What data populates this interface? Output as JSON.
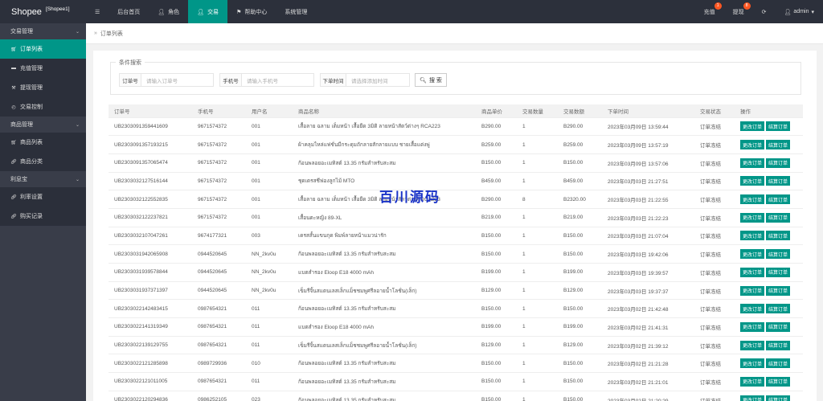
{
  "app": {
    "brand": "Shopee",
    "sub": "[Shopee1]"
  },
  "topnav": {
    "menu_icon": "hamburger-icon",
    "items": [
      {
        "label": "后台首页",
        "icon": ""
      },
      {
        "label": "角色",
        "icon": "user-icon"
      },
      {
        "label": "交易",
        "icon": "user-icon",
        "active": true
      },
      {
        "label": "帮助中心",
        "icon": "flag-icon"
      },
      {
        "label": "系统管理",
        "icon": ""
      }
    ]
  },
  "topright": {
    "recharge": {
      "label": "充值",
      "badge": "1"
    },
    "withdraw": {
      "label": "提现",
      "badge": "8"
    },
    "refresh_icon": "refresh-icon",
    "user": "admin"
  },
  "sidebar": {
    "groups": [
      {
        "label": "交易管理",
        "items": [
          {
            "label": "订单列表",
            "icon": "cart-icon",
            "active": true
          },
          {
            "label": "充值管理",
            "icon": "card-icon"
          },
          {
            "label": "提现管理",
            "icon": "hammer-icon"
          },
          {
            "label": "交易控制",
            "icon": "dashboard-icon"
          }
        ]
      },
      {
        "label": "商品管理",
        "items": [
          {
            "label": "商品列表",
            "icon": "cart-icon"
          },
          {
            "label": "商品分类",
            "icon": "link-icon"
          }
        ]
      },
      {
        "label": "利息宝",
        "items": [
          {
            "label": "利率设置",
            "icon": "link-icon"
          },
          {
            "label": "购买记录",
            "icon": "link-icon"
          }
        ]
      }
    ]
  },
  "breadcrumb": {
    "sep": "»",
    "label": "订单列表"
  },
  "search": {
    "legend": "条件搜索",
    "fields": [
      {
        "label": "订单号",
        "placeholder": "请输入订单号"
      },
      {
        "label": "手机号",
        "placeholder": "请输入手机号"
      },
      {
        "label": "下单时间",
        "placeholder": "请选择添加时间"
      }
    ],
    "button": "搜 索"
  },
  "table": {
    "headers": [
      "订单号",
      "手机号",
      "用户名",
      "商品名称",
      "商品单价",
      "交易数量",
      "交易数额",
      "下单时间",
      "交易状态",
      "操作"
    ],
    "action_edit": "更改订单",
    "action_settle": "结算订单",
    "rows": [
      [
        "UB2303091359441609",
        "9671574372",
        "001",
        "เสื้อลาย ฉลาม เต็มหน้า เสื้อยืด 3มิติ ลายหน้าสัตว์ต่างๆ RCA223",
        "B290.00",
        "1",
        "B290.00",
        "2023年03月09日 13:59:44",
        "订单冻结"
      ],
      [
        "UB2303091357193215",
        "9671574372",
        "001",
        "ผ้าคลุมไหล่แฟชั่นมีกระดุมถักลายสักลายแบบ ชายเสื้อแต่งพู่",
        "B259.00",
        "1",
        "B259.00",
        "2023年03月09日 13:57:19",
        "订单冻结"
      ],
      [
        "UB2303091357065474",
        "9671574372",
        "001",
        "ก้อนพลอยอะเมทิสต์ 13.35 กรัมสำหรับสะสม",
        "B150.00",
        "1",
        "B150.00",
        "2023年03月09日 13:57:06",
        "订单冻结"
      ],
      [
        "UB2303032127516144",
        "9671574372",
        "001",
        "ชุดเดรสชีฟองลูกไม้ MTO",
        "B459.00",
        "1",
        "B459.00",
        "2023年03月03日 21:27:51",
        "订单冻结"
      ],
      [
        "UB2303032122552835",
        "9671574372",
        "001",
        "เสื้อลาย ฉลาม เต็มหน้า เสื้อยืด 3มิติ ลายหน้าสัตว์ต่างๆ RCA223",
        "B290.00",
        "8",
        "B2320.00",
        "2023年03月03日 21:22:55",
        "订单冻结"
      ],
      [
        "UB2303032122237821",
        "9671574372",
        "001",
        "เสื้อนตะหญิง 89-XL",
        "B219.00",
        "1",
        "B219.00",
        "2023年03月03日 21:22:23",
        "订单冻结"
      ],
      [
        "UB2303032107047261",
        "9674177321",
        "003",
        "เดรสสั้นแขนกุด พิมพ์ลายหน้าแมวน่ารัก",
        "B150.00",
        "1",
        "B150.00",
        "2023年03月03日 21:07:04",
        "订单冻结"
      ],
      [
        "UB2303031942065908",
        "0944520645",
        "NN_2kv0u",
        "ก้อนพลอยอะเมทิสต์ 13.35 กรัมสำหรับสะสม",
        "B150.00",
        "1",
        "B150.00",
        "2023年03月03日 19:42:06",
        "订单冻结"
      ],
      [
        "UB2303031939578844",
        "0944520645",
        "NN_2kv0u",
        "แบตสำรอง Eloop E18 4000 mAh",
        "B199.00",
        "1",
        "B199.00",
        "2023年03月03日 19:39:57",
        "订单冻结"
      ],
      [
        "UB2303031937371397",
        "0944520645",
        "NN_2kv0u",
        "เข็มรีจิ้นสแตนเลสเล็กแม็ชชมพูศรีลอายน้ำโลชั่น(เล็ก)",
        "B129.00",
        "1",
        "B129.00",
        "2023年03月03日 19:37:37",
        "订单冻结"
      ],
      [
        "UB2303022142483415",
        "0987654321",
        "011",
        "ก้อนพลอยอะเมทิสต์ 13.35 กรัมสำหรับสะสม",
        "B150.00",
        "1",
        "B150.00",
        "2023年03月02日 21:42:48",
        "订单冻结"
      ],
      [
        "UB2303022141319349",
        "0987654321",
        "011",
        "แบตสำรอง Eloop E18 4000 mAh",
        "B199.00",
        "1",
        "B199.00",
        "2023年03月02日 21:41:31",
        "订单冻结"
      ],
      [
        "UB2303022139129755",
        "0987654321",
        "011",
        "เข็มรีจิ้นสแตนเลสเล็กแม็ชชมพูศรีลอายน้ำโลชั่น(เล็ก)",
        "B129.00",
        "1",
        "B129.00",
        "2023年03月02日 21:39:12",
        "订单冻结"
      ],
      [
        "UB2303022121285898",
        "0989729936",
        "010",
        "ก้อนพลอยอะเมทิสต์ 13.35 กรัมสำหรับสะสม",
        "B150.00",
        "1",
        "B150.00",
        "2023年03月02日 21:21:28",
        "订单冻结"
      ],
      [
        "UB2303022121011005",
        "0987654321",
        "011",
        "ก้อนพลอยอะเมทิสต์ 13.35 กรัมสำหรับสะสม",
        "B150.00",
        "1",
        "B150.00",
        "2023年03月02日 21:21:01",
        "订单冻结"
      ],
      [
        "UB2303022120294836",
        "0986252105",
        "023",
        "ก้อนพลอยอะเมทิสต์ 13.35 กรัมสำหรับสะสม",
        "B150.00",
        "1",
        "B150.00",
        "2023年03月02日 21:20:29",
        "订单冻结"
      ]
    ]
  },
  "watermark": "百川源码"
}
